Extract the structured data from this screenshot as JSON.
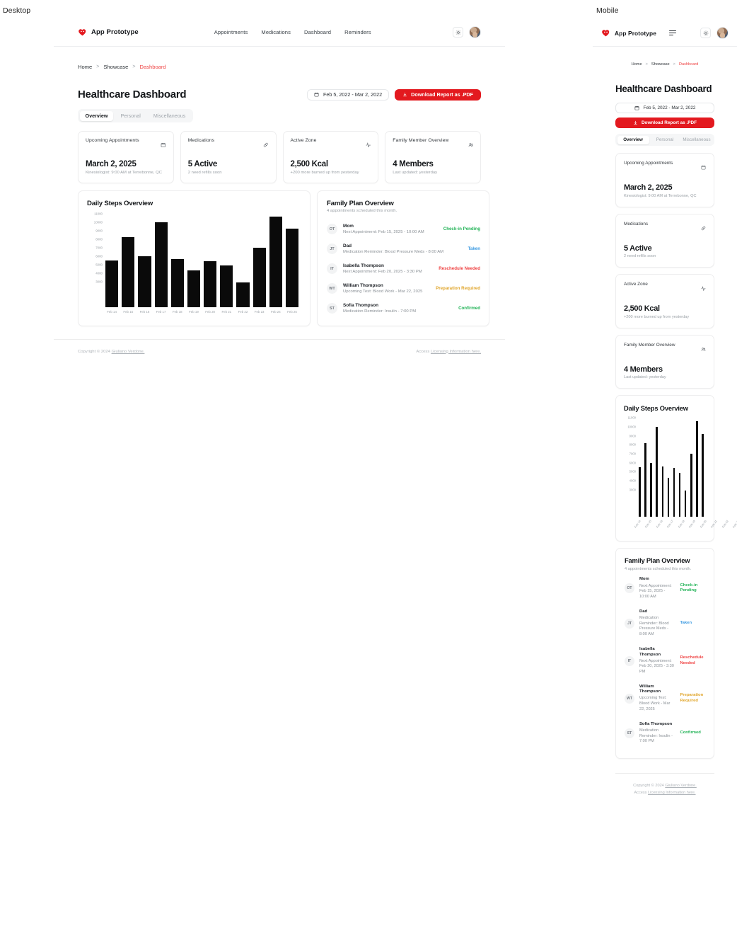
{
  "viewports": {
    "desktop_label": "Desktop",
    "mobile_label": "Mobile"
  },
  "brand": {
    "name": "App Prototype",
    "logo_icon": "heart-icon",
    "color": "#e3191f"
  },
  "nav": {
    "links": [
      {
        "label": "Appointments"
      },
      {
        "label": "Medications"
      },
      {
        "label": "Dashboard"
      },
      {
        "label": "Reminders"
      }
    ],
    "theme_toggle_icon": "sun-icon",
    "menu_icon": "hamburger-icon",
    "avatar_icon": "user-avatar"
  },
  "breadcrumb": {
    "home": "Home",
    "showcase": "Showcase",
    "current": "Dashboard",
    "separator": ">"
  },
  "header": {
    "title": "Healthcare Dashboard",
    "date_range": "Feb 5, 2022 - Mar 2, 2022",
    "date_range_icon": "calendar-icon",
    "download_label": "Download Report as .PDF",
    "download_icon": "download-icon",
    "download_color": "#e3191f"
  },
  "tabs": [
    {
      "label": "Overview",
      "active": true
    },
    {
      "label": "Personal",
      "active": false
    },
    {
      "label": "Miscellaneous",
      "active": false
    }
  ],
  "stats": [
    {
      "label": "Upcoming Appointments",
      "icon": "calendar-icon",
      "value": "March 2, 2025",
      "sub": "Kinesiologist: 9:00 AM at Terrebonne, QC"
    },
    {
      "label": "Medications",
      "icon": "pill-icon",
      "value": "5 Active",
      "sub": "2 need refills soon"
    },
    {
      "label": "Active Zone",
      "icon": "activity-icon",
      "value": "2,500 Kcal",
      "sub": "+200 more burned up from yesterday"
    },
    {
      "label": "Family Member Overview",
      "icon": "users-icon",
      "value": "4 Members",
      "sub": "Last updated: yesterday"
    }
  ],
  "chart_panel": {
    "title": "Daily Steps Overview"
  },
  "chart_data": {
    "type": "bar",
    "title": "Daily Steps Overview",
    "xlabel": "",
    "ylabel": "",
    "categories": [
      "Feb 14",
      "Feb 15",
      "Feb 16",
      "Feb 17",
      "Feb 18",
      "Feb 19",
      "Feb 20",
      "Feb 21",
      "Feb 22",
      "Feb 23",
      "Feb 24",
      "Feb 25"
    ],
    "values": [
      5500,
      8200,
      6000,
      10000,
      5600,
      4300,
      5400,
      4900,
      2900,
      7000,
      10600,
      9200
    ],
    "yticks": [
      11000,
      10000,
      9000,
      8000,
      7000,
      6000,
      5000,
      4000,
      3000
    ],
    "ylim": [
      0,
      11000
    ],
    "grid": false,
    "legend": false,
    "bar_color": "#0a0a0a"
  },
  "family_panel": {
    "title": "Family Plan Overview",
    "subtitle": "4 appointments scheduled this month.",
    "members": [
      {
        "initials": "OT",
        "name": "Mom",
        "detail": "Next Appointment: Feb 15, 2025 - 10:00 AM",
        "status": "Check-in Pending",
        "status_color": "#22b357"
      },
      {
        "initials": "JT",
        "name": "Dad",
        "detail": "Medication Reminder: Blood Pressure Meds - 8:00 AM",
        "status": "Taken",
        "status_color": "#3b9ae1"
      },
      {
        "initials": "IT",
        "name": "Isabella Thompson",
        "detail": "Next Appointment: Feb 20, 2025 - 3:30 PM",
        "status": "Reschedule Needed",
        "status_color": "#ef4444"
      },
      {
        "initials": "WT",
        "name": "William Thompson",
        "detail": "Upcoming Test: Blood Work - Mar 22, 2025",
        "status": "Preparation Required",
        "status_color": "#e0a52a"
      },
      {
        "initials": "ST",
        "name": "Sofia Thompson",
        "detail": "Medication Reminder: Insulin - 7:00 PM",
        "status": "Confirmed",
        "status_color": "#22b357"
      }
    ]
  },
  "footer": {
    "copyright_prefix": "Copyright © 2024 ",
    "copyright_name": "Giuliano Verdone.",
    "access_prefix": "Access ",
    "access_link": "Licensing Information here."
  }
}
